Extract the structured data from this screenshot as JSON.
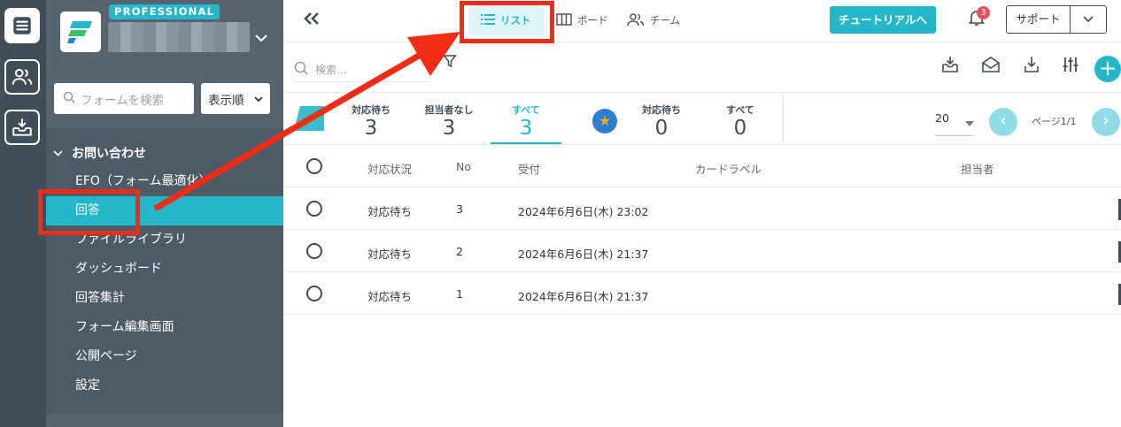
{
  "sidebar": {
    "badge": "PROFESSIONAL",
    "form_search_placeholder": "フォームを検索",
    "sort_label": "表示順",
    "group_label": "お問い合わせ",
    "items": [
      {
        "label": "EFO（フォーム最適化）"
      },
      {
        "label": "回答",
        "active": true
      },
      {
        "label": "ファイルライブラリ"
      },
      {
        "label": "ダッシュボード"
      },
      {
        "label": "回答集計"
      },
      {
        "label": "フォーム編集画面"
      },
      {
        "label": "公開ページ"
      },
      {
        "label": "設定"
      }
    ]
  },
  "topbar": {
    "view_tabs": [
      {
        "label": "リスト",
        "icon": "list-icon",
        "active": true
      },
      {
        "label": "ボード",
        "icon": "board-icon"
      },
      {
        "label": "チーム",
        "icon": "team-icon"
      }
    ],
    "tutorial_label": "チュートリアルへ",
    "notification_count": "3",
    "support_label": "サポート"
  },
  "search": {
    "placeholder": "検索..."
  },
  "status": {
    "mine": [
      {
        "label": "対応待ち",
        "value": "3"
      },
      {
        "label": "担当者なし",
        "value": "3"
      },
      {
        "label": "すべて",
        "value": "3",
        "active": true
      }
    ],
    "team": [
      {
        "label": "対応待ち",
        "value": "0"
      },
      {
        "label": "すべて",
        "value": "0"
      }
    ],
    "per_page": "20",
    "page_info": "ページ1/1"
  },
  "table": {
    "headers": {
      "status": "対応状況",
      "no": "No",
      "received": "受付",
      "card_label": "カードラベル",
      "assignee": "担当者"
    },
    "rows": [
      {
        "status": "対応待ち",
        "no": "3",
        "received": "2024年6月6日(木) 23:02"
      },
      {
        "status": "対応待ち",
        "no": "2",
        "received": "2024年6月6日(木) 21:37"
      },
      {
        "status": "対応待ち",
        "no": "1",
        "received": "2024年6月6日(木) 21:37"
      }
    ]
  },
  "colors": {
    "accent": "#25b7c9",
    "sidebar": "#4c5b66",
    "callout": "#f02c16"
  }
}
